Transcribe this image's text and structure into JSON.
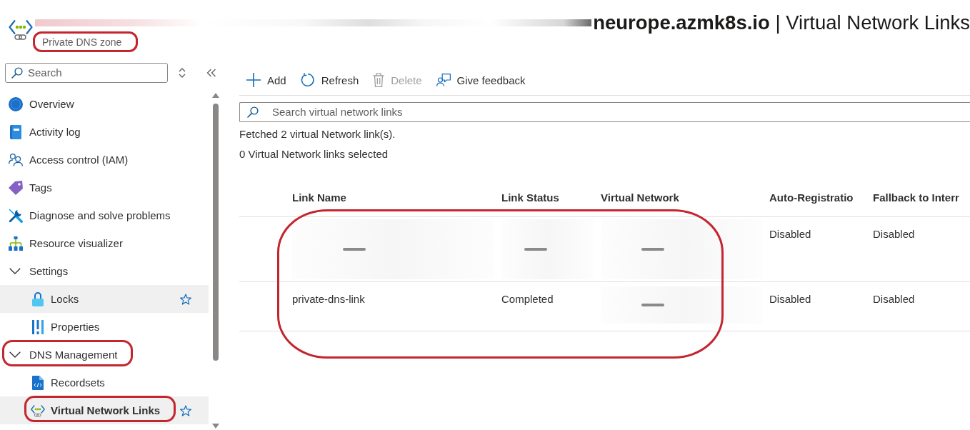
{
  "header": {
    "title": {
      "prefix_redacted": true,
      "text": "**neurope.azmk8s.io** | Virtual Network Links"
    },
    "subtitle": {
      "text": "Private DNS zone",
      "circled": true
    }
  },
  "sidebar": {
    "search": {
      "placeholder": "Search"
    },
    "items": [
      {
        "label": "Overview",
        "kind": "overview",
        "selected": false,
        "highlighted": false,
        "circled": false
      },
      {
        "label": "Activity log",
        "kind": "log",
        "selected": false,
        "highlighted": false,
        "circled": false
      },
      {
        "label": "Access control (IAM)",
        "kind": "access",
        "selected": false,
        "highlighted": false,
        "circled": false
      },
      {
        "label": "Tags",
        "kind": "tags",
        "selected": false,
        "highlighted": false,
        "circled": false
      },
      {
        "label": "Diagnose and solve problems",
        "kind": "diagnose",
        "selected": false,
        "highlighted": false,
        "circled": false
      },
      {
        "label": "Resource visualizer",
        "kind": "visualizer",
        "selected": false,
        "highlighted": false,
        "circled": false
      },
      {
        "label": "Settings",
        "kind": "group",
        "expanded": true,
        "selected": false,
        "highlighted": false,
        "circled": false,
        "children": [
          {
            "label": "Locks",
            "kind": "locks",
            "selected": false,
            "highlighted": true,
            "circled": false
          },
          {
            "label": "Properties",
            "kind": "properties",
            "selected": false,
            "highlighted": false,
            "circled": false
          }
        ]
      },
      {
        "label": "DNS Management",
        "kind": "group",
        "expanded": true,
        "selected": false,
        "highlighted": false,
        "circled": true,
        "children": [
          {
            "label": "Recordsets",
            "kind": "recordsets",
            "selected": false,
            "highlighted": false,
            "circled": false
          },
          {
            "label": "Virtual Network Links",
            "kind": "links",
            "selected": true,
            "highlighted": false,
            "circled": true
          }
        ]
      }
    ]
  },
  "toolbar": [
    {
      "label": "Add",
      "kind": "add",
      "disabled": false
    },
    {
      "label": "Refresh",
      "kind": "refresh",
      "disabled": false
    },
    {
      "label": "Delete",
      "kind": "delete",
      "disabled": true
    },
    {
      "label": "Give feedback",
      "kind": "feedback",
      "disabled": false
    }
  ],
  "search": {
    "placeholder": "Search virtual network links"
  },
  "messages": [
    "Fetched 2 virtual Network link(s).",
    "0 Virtual Network links selected"
  ],
  "table": {
    "circled": true,
    "columns": [
      "Link Name",
      "Link Status",
      "Virtual Network",
      "Auto-Registratio",
      "Fallback to Interr"
    ],
    "rows": [
      {
        "selected": false,
        "cells": [
          {
            "kind": "redacted"
          },
          {
            "kind": "redacted"
          },
          {
            "kind": "redacted"
          },
          {
            "kind": "text",
            "text": "Disabled"
          },
          {
            "kind": "text",
            "text": "Disabled"
          }
        ]
      },
      {
        "selected": false,
        "cells": [
          {
            "kind": "text",
            "text": "private-dns-link"
          },
          {
            "kind": "text",
            "text": "Completed"
          },
          {
            "kind": "redacted_line"
          },
          {
            "kind": "text",
            "text": "Disabled"
          },
          {
            "kind": "text",
            "text": "Disabled"
          }
        ]
      }
    ]
  }
}
